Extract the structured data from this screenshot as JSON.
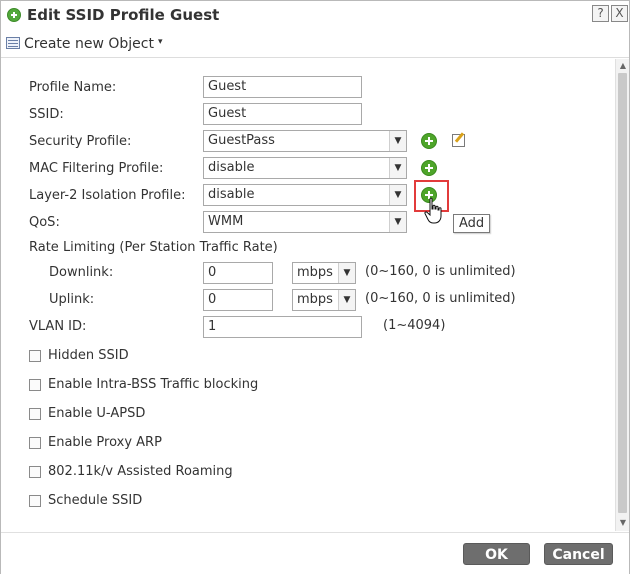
{
  "dialog": {
    "title": "Edit SSID Profile Guest",
    "help_glyph": "?",
    "close_glyph": "X"
  },
  "toolbar": {
    "create_label": "Create new Object",
    "caret": "▾"
  },
  "form": {
    "profile_name": {
      "label": "Profile Name:",
      "value": "Guest"
    },
    "ssid": {
      "label": "SSID:",
      "value": "Guest"
    },
    "security_profile": {
      "label": "Security Profile:",
      "value": "GuestPass"
    },
    "mac_filtering": {
      "label": "MAC Filtering Profile:",
      "value": "disable"
    },
    "layer2_isolation": {
      "label": "Layer-2 Isolation Profile:",
      "value": "disable"
    },
    "qos": {
      "label": "QoS:",
      "value": "WMM"
    },
    "rate_limiting": {
      "label": "Rate Limiting (Per Station Traffic Rate)"
    },
    "downlink": {
      "label": "Downlink:",
      "value": "0",
      "unit": "mbps",
      "hint": "(0~160, 0 is unlimited)"
    },
    "uplink": {
      "label": "Uplink:",
      "value": "0",
      "unit": "mbps",
      "hint": "(0~160, 0 is unlimited)"
    },
    "vlan": {
      "label": "VLAN ID:",
      "value": "1",
      "hint": "(1~4094)"
    }
  },
  "checkboxes": [
    {
      "label": "Hidden SSID",
      "checked": false
    },
    {
      "label": "Enable Intra-BSS Traffic blocking",
      "checked": false
    },
    {
      "label": "Enable U-APSD",
      "checked": false
    },
    {
      "label": "Enable Proxy ARP",
      "checked": false
    },
    {
      "label": "802.11k/v Assisted Roaming",
      "checked": false
    },
    {
      "label": "Schedule SSID",
      "checked": false
    }
  ],
  "tooltip": {
    "text": "Add"
  },
  "footer": {
    "ok_label": "OK",
    "cancel_label": "Cancel"
  },
  "colors": {
    "add_icon": "#4ea52a",
    "highlight": "#e23b3b",
    "button": "#6e6e6e"
  },
  "icons": [
    "add-icon",
    "edit-icon",
    "create-object-icon",
    "pointer-hand-icon"
  ]
}
